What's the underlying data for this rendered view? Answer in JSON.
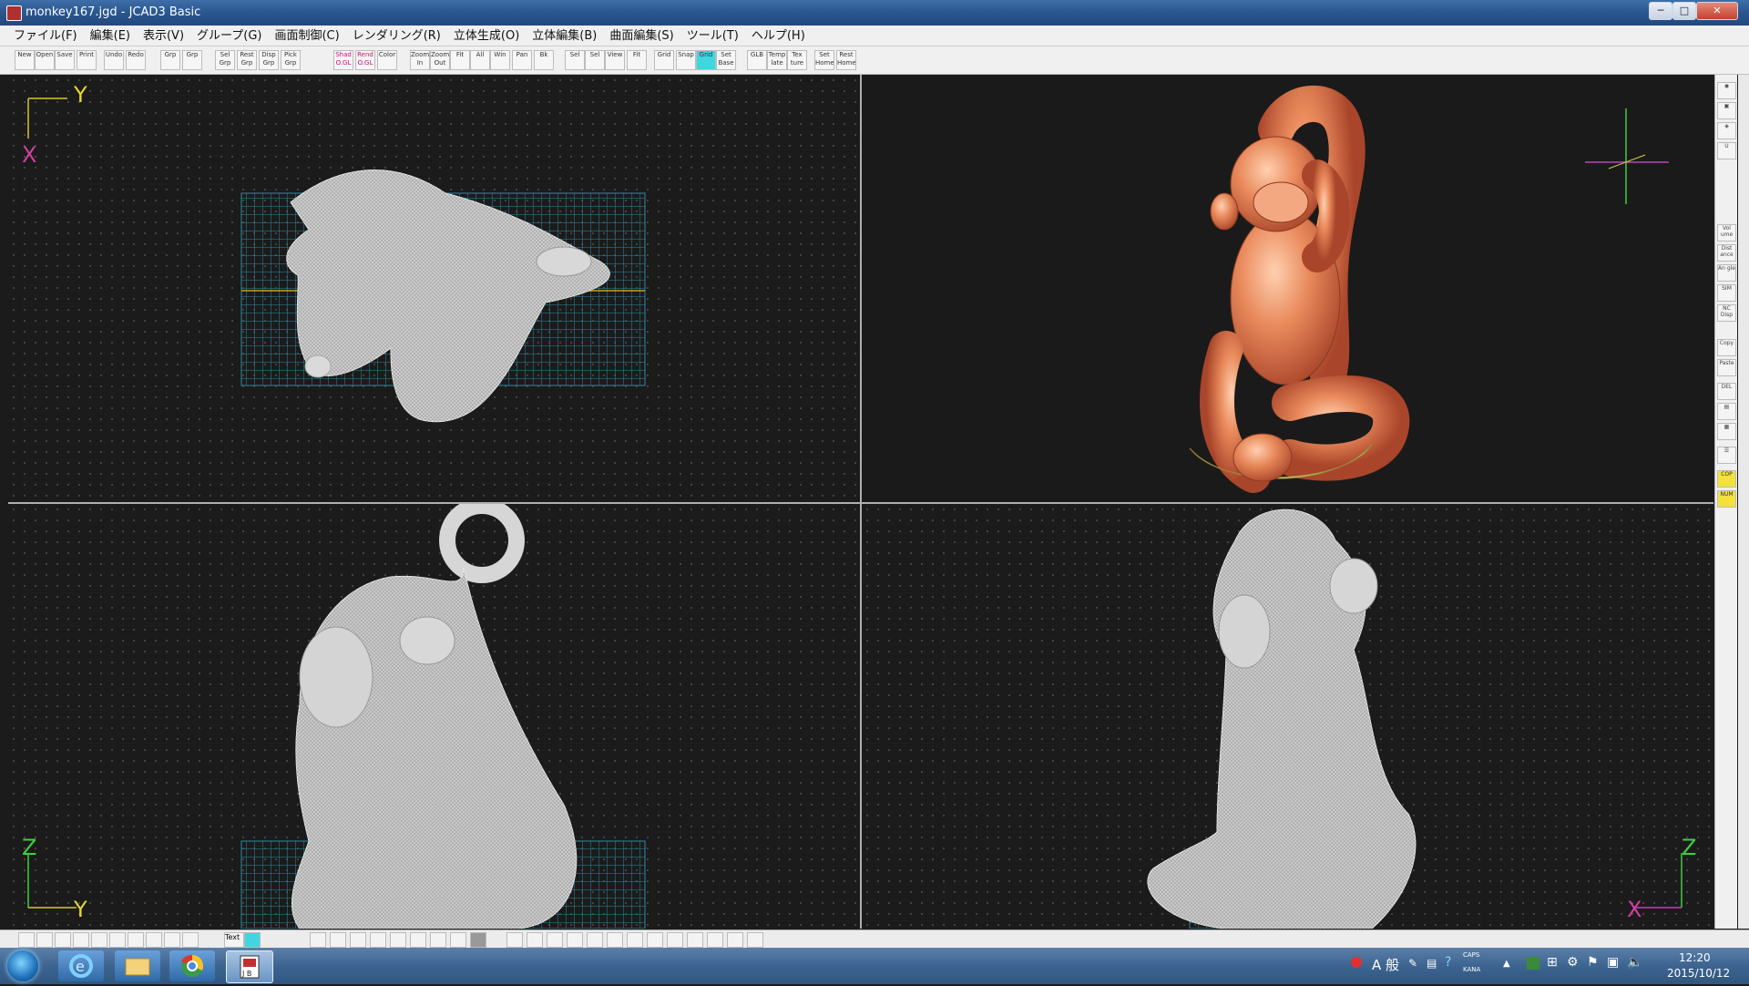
{
  "window": {
    "title": "monkey167.jgd - JCAD3 Basic"
  },
  "menu": [
    "ファイル(F)",
    "編集(E)",
    "表示(V)",
    "グループ(G)",
    "画面制御(C)",
    "レンダリング(R)",
    "立体生成(O)",
    "立体編集(B)",
    "曲面編集(S)",
    "ツール(T)",
    "ヘルプ(H)"
  ],
  "toolbar": [
    "New",
    "Open",
    "Save",
    "Print",
    "Undo",
    "Redo",
    "Grp",
    "Grp",
    "Sel Grp",
    "Rest Grp",
    "Disp Grp",
    "Pick Grp",
    "Shad O.GL",
    "Rend O.GL",
    "Color",
    "Zoom In",
    "Zoom Out",
    "Fit",
    "All",
    "Win",
    "Pan",
    "Bk",
    "Sel",
    "Sel",
    "View",
    "Fit",
    "Grid",
    "Snap",
    "Grid",
    "Set Base",
    "GLB",
    "Temp late",
    "Tex ture",
    "Set Home",
    "Rest Home"
  ],
  "viewports": {
    "top": {
      "h_axis": "Y",
      "v_axis": "X"
    },
    "front": {
      "h_axis": "Y",
      "v_axis": "Z"
    },
    "side": {
      "h_axis": "X",
      "v_axis": "Z"
    }
  },
  "right_panel": [
    "Vol ume",
    "Dist ance",
    "An gle",
    "SIM",
    "NC Disp",
    "Copy",
    "Paste",
    "DEL",
    "COP",
    "NUM"
  ],
  "status_bar": {
    "mode": "Text"
  },
  "taskbar": {
    "ime": "A 般",
    "caps": "CAPS",
    "kana": "KANA",
    "time": "12:20",
    "date": "2015/10/12"
  }
}
